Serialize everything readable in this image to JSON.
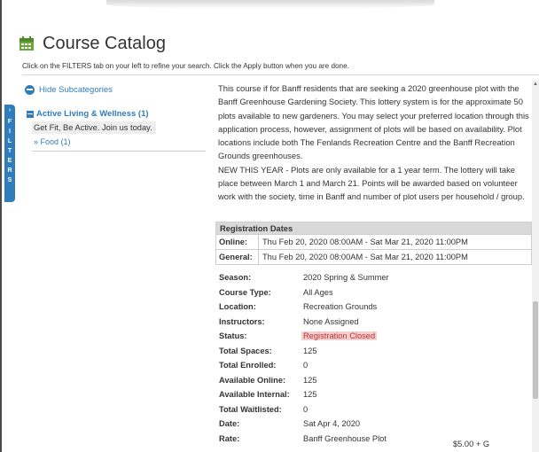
{
  "header": {
    "title": "Course Catalog",
    "icon": "calendar-icon",
    "icon_color": "#6aa83c"
  },
  "instructions": "Click on the FILTERS tab on your left to refine your search. Click the Apply button when you are done.",
  "filters_tab": {
    "letters": [
      "F",
      "I",
      "L",
      "T",
      "E",
      "R",
      "S"
    ],
    "color": "#2f7dbd"
  },
  "sidebar": {
    "hide_subcategories": "Hide Subcategories",
    "category": {
      "label": "Active Living & Wellness (1)",
      "description": "Get Fit, Be Active. Join us today.",
      "subcategory": "» Food (1)"
    }
  },
  "course": {
    "description": [
      "This course if for Banff residents that are seeking a 2020 greenhouse plot with the Banff Greenhouse Gardening Society. This lottery system is for the approximate 50 plots available to new gardeners. You may select your preferred location through this application process, however, assignment of plots will be based on availability. Plot locations include both The Fenlands Recreation Centre and the Banff Recreation Grounds greenhouses.",
      "NEW THIS YEAR - Plots are only available for a 1 year term. The lottery will take place between March 1 and March 21. Points will be awarded based on volunteer work with the society, time in Banff and number of plot users per household / group."
    ],
    "registration": {
      "title": "Registration Dates",
      "rows": [
        {
          "label": "Online:",
          "value": "Thu Feb 20, 2020  08:00AM - Sat Mar 21, 2020  11:00PM"
        },
        {
          "label": "General:",
          "value": "Thu Feb 20, 2020  08:00AM - Sat Mar 21, 2020  11:00PM"
        }
      ]
    },
    "details": {
      "season": {
        "label": "Season:",
        "value": "2020 Spring & Summer"
      },
      "course_type": {
        "label": "Course Type:",
        "value": "All Ages"
      },
      "location": {
        "label": "Location:",
        "value": "Recreation Grounds"
      },
      "instructors": {
        "label": "Instructors:",
        "value": "None Assigned"
      },
      "status": {
        "label": "Status:",
        "value": "Registration Closed"
      },
      "total_spaces": {
        "label": "Total Spaces:",
        "value": "125"
      },
      "total_enrolled": {
        "label": "Total Enrolled:",
        "value": "0"
      },
      "available_online": {
        "label": "Available Online:",
        "value": "125"
      },
      "available_internal": {
        "label": "Available Internal:",
        "value": "125"
      },
      "total_waitlisted": {
        "label": "Total Waitlisted:",
        "value": "0"
      },
      "date": {
        "label": "Date:",
        "value": "Sat Apr 4, 2020"
      },
      "rate": {
        "label": "Rate:",
        "value": "Banff Greenhouse Plot",
        "price": "$5.00 + G"
      }
    }
  }
}
